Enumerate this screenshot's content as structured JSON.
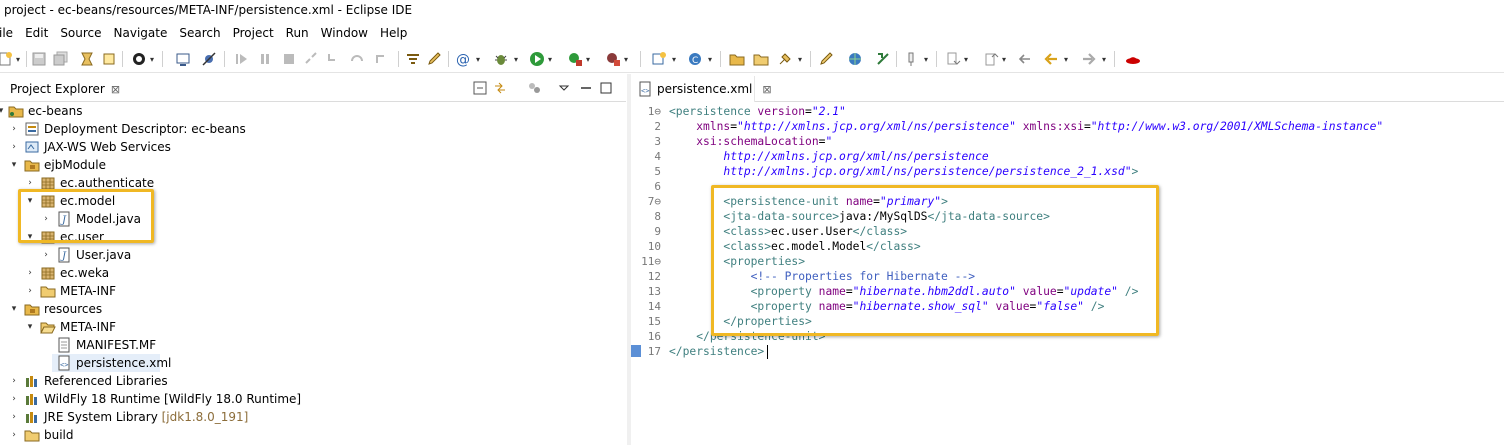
{
  "window": {
    "title": "project - ec-beans/resources/META-INF/persistence.xml - Eclipse IDE"
  },
  "menu": [
    "ile",
    "Edit",
    "Source",
    "Navigate",
    "Search",
    "Project",
    "Run",
    "Window",
    "Help"
  ],
  "project_explorer": {
    "tab_label": "Project Explorer",
    "tab_close": "⊠",
    "tree": [
      {
        "label": "ec-beans",
        "icon": "project-icon",
        "expanded": true
      },
      {
        "label": "Deployment Descriptor: ec-beans",
        "icon": "deployment-descriptor-icon"
      },
      {
        "label": "JAX-WS Web Services",
        "icon": "web-services-icon"
      },
      {
        "label": "ejbModule",
        "icon": "source-folder-icon",
        "expanded": true
      },
      {
        "label": "ec.authenticate",
        "icon": "package-icon"
      },
      {
        "label": "ec.model",
        "icon": "package-icon",
        "expanded": true
      },
      {
        "label": "Model.java",
        "icon": "java-file-icon"
      },
      {
        "label": "ec.user",
        "icon": "package-icon",
        "expanded": true
      },
      {
        "label": "User.java",
        "icon": "java-file-icon"
      },
      {
        "label": "ec.weka",
        "icon": "package-icon"
      },
      {
        "label": "META-INF",
        "icon": "folder-icon"
      },
      {
        "label": "resources",
        "icon": "source-folder-icon",
        "expanded": true
      },
      {
        "label": "META-INF",
        "icon": "folder-open-icon",
        "expanded": true
      },
      {
        "label": "MANIFEST.MF",
        "icon": "manifest-file-icon"
      },
      {
        "label": "persistence.xml",
        "icon": "xml-file-icon"
      },
      {
        "label": "Referenced Libraries",
        "icon": "library-icon"
      },
      {
        "label": "WildFly 18 Runtime [WildFly 18.0 Runtime]",
        "icon": "library-icon"
      },
      {
        "label": "JRE System Library",
        "suffix": "[jdk1.8.0_191]",
        "icon": "library-icon"
      },
      {
        "label": "build",
        "icon": "folder-icon"
      }
    ]
  },
  "editor": {
    "tab_label": "persistence.xml",
    "tab_close": "⊠",
    "line_numbers": [
      "1⊖",
      "2",
      "3",
      "4",
      "5",
      "6",
      "7⊖",
      "8",
      "9",
      "10",
      "11⊖",
      "12",
      "13",
      "14",
      "15",
      "16",
      "17"
    ],
    "lines": [
      [
        [
          "tag",
          "<persistence "
        ],
        [
          "attr",
          "version"
        ],
        [
          "txt",
          "="
        ],
        [
          "val",
          "\"2.1\""
        ]
      ],
      [
        [
          "txt",
          "    "
        ],
        [
          "attr",
          "xmlns"
        ],
        [
          "txt",
          "="
        ],
        [
          "val",
          "\"http://xmlns.jcp.org/xml/ns/persistence\""
        ],
        [
          "txt",
          " "
        ],
        [
          "attr",
          "xmlns:xsi"
        ],
        [
          "txt",
          "="
        ],
        [
          "val",
          "\"http://www.w3.org/2001/XMLSchema-instance\""
        ]
      ],
      [
        [
          "txt",
          "    "
        ],
        [
          "attr",
          "xsi:schemaLocation"
        ],
        [
          "txt",
          "="
        ],
        [
          "val",
          "\""
        ]
      ],
      [
        [
          "txt",
          "        "
        ],
        [
          "val",
          "http://xmlns.jcp.org/xml/ns/persistence"
        ]
      ],
      [
        [
          "txt",
          "        "
        ],
        [
          "val",
          "http://xmlns.jcp.org/xml/ns/persistence/persistence_2_1.xsd\""
        ],
        [
          "tag",
          ">"
        ]
      ],
      [],
      [
        [
          "txt",
          "        "
        ],
        [
          "tag",
          "<persistence-unit "
        ],
        [
          "attr",
          "name"
        ],
        [
          "txt",
          "="
        ],
        [
          "val",
          "\"primary\""
        ],
        [
          "tag",
          ">"
        ]
      ],
      [
        [
          "txt",
          "        "
        ],
        [
          "tag",
          "<jta-data-source>"
        ],
        [
          "txt",
          "java:/MySqlDS"
        ],
        [
          "tag",
          "</jta-data-source>"
        ]
      ],
      [
        [
          "txt",
          "        "
        ],
        [
          "tag",
          "<class>"
        ],
        [
          "txt",
          "ec.user.User"
        ],
        [
          "tag",
          "</class>"
        ]
      ],
      [
        [
          "txt",
          "        "
        ],
        [
          "tag",
          "<class>"
        ],
        [
          "txt",
          "ec.model.Model"
        ],
        [
          "tag",
          "</class>"
        ]
      ],
      [
        [
          "txt",
          "        "
        ],
        [
          "tag",
          "<properties>"
        ]
      ],
      [
        [
          "txt",
          "            "
        ],
        [
          "cmt",
          "<!-- Properties for Hibernate -->"
        ]
      ],
      [
        [
          "txt",
          "            "
        ],
        [
          "tag",
          "<property "
        ],
        [
          "attr",
          "name"
        ],
        [
          "txt",
          "="
        ],
        [
          "val",
          "\"hibernate.hbm2ddl.auto\""
        ],
        [
          "txt",
          " "
        ],
        [
          "attr",
          "value"
        ],
        [
          "txt",
          "="
        ],
        [
          "val",
          "\"update\""
        ],
        [
          "txt",
          " "
        ],
        [
          "tag",
          "/>"
        ]
      ],
      [
        [
          "txt",
          "            "
        ],
        [
          "tag",
          "<property "
        ],
        [
          "attr",
          "name"
        ],
        [
          "txt",
          "="
        ],
        [
          "val",
          "\"hibernate.show_sql\""
        ],
        [
          "txt",
          " "
        ],
        [
          "attr",
          "value"
        ],
        [
          "txt",
          "="
        ],
        [
          "val",
          "\"false\""
        ],
        [
          "txt",
          " "
        ],
        [
          "tag",
          "/>"
        ]
      ],
      [
        [
          "txt",
          "        "
        ],
        [
          "tag",
          "</properties>"
        ]
      ],
      [
        [
          "txt",
          "    "
        ],
        [
          "tag",
          "</persistence-unit>"
        ]
      ],
      [
        [
          "tag",
          "</persistence>"
        ]
      ]
    ]
  },
  "colors": {
    "highlight": "#f0b824",
    "xml_tag": "#3f7f7f",
    "xml_attr": "#7f007f",
    "xml_value": "#2a00ff",
    "xml_comment": "#3f5fbf"
  }
}
